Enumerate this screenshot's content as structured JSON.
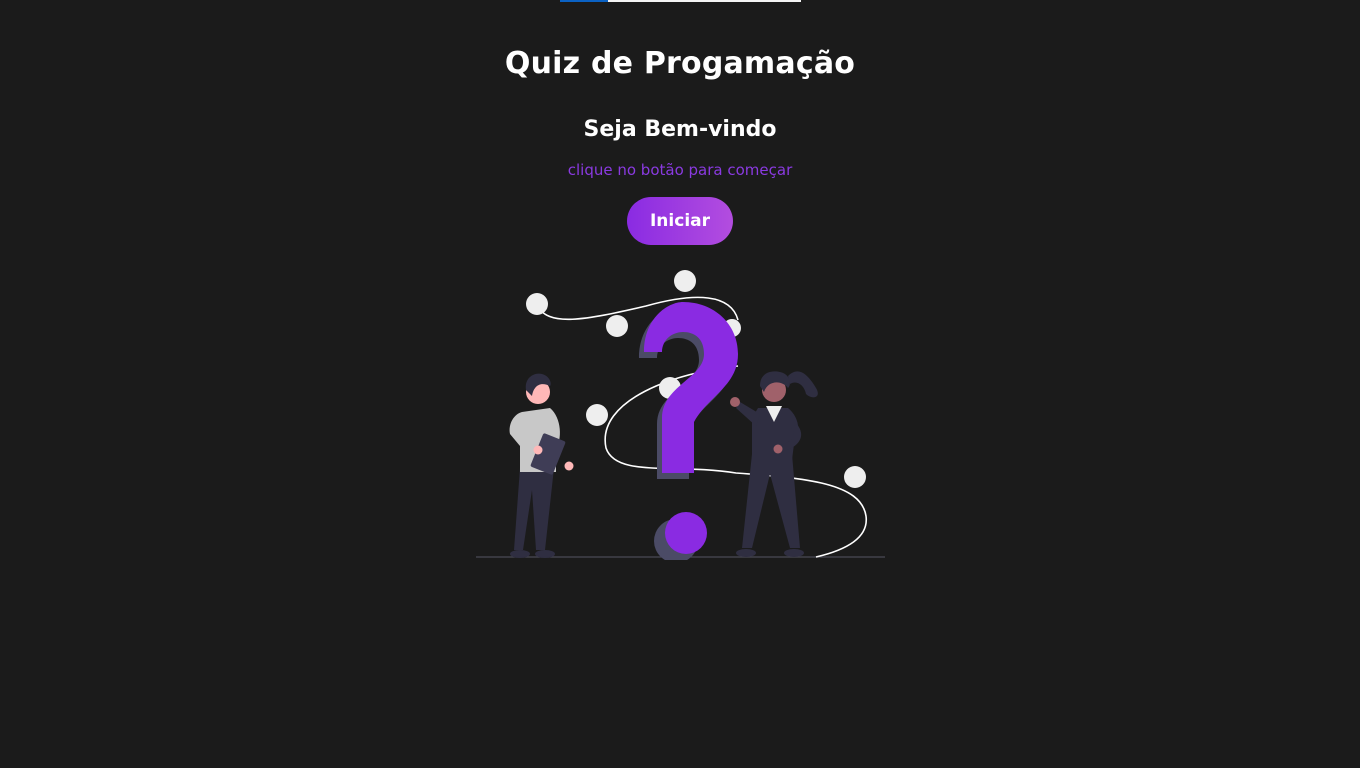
{
  "quiz": {
    "progress_percent": 20,
    "title": "Quiz de Progamação",
    "welcome": "Seja Bem-vindo",
    "hint": "clique no botão para começar",
    "start_label": "Iniciar"
  },
  "illustration": {
    "icon": "question-people-illustration",
    "accent_color": "#8a2be2"
  },
  "colors": {
    "background": "#1b1b1b",
    "accent": "#8a3ae0",
    "progress_fill": "#0b62c4",
    "progress_track": "#f4f4f4"
  }
}
